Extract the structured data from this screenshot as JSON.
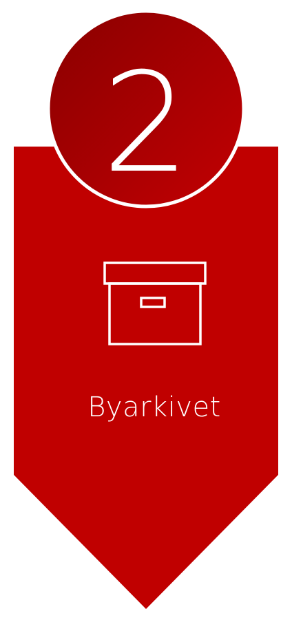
{
  "step": {
    "number": "2",
    "label": "Byarkivet",
    "icon": "archive-box-icon"
  },
  "colors": {
    "banner": "#c00000",
    "circle_light": "#c20003",
    "circle_dark": "#8a0000",
    "stroke": "#ffffff"
  }
}
